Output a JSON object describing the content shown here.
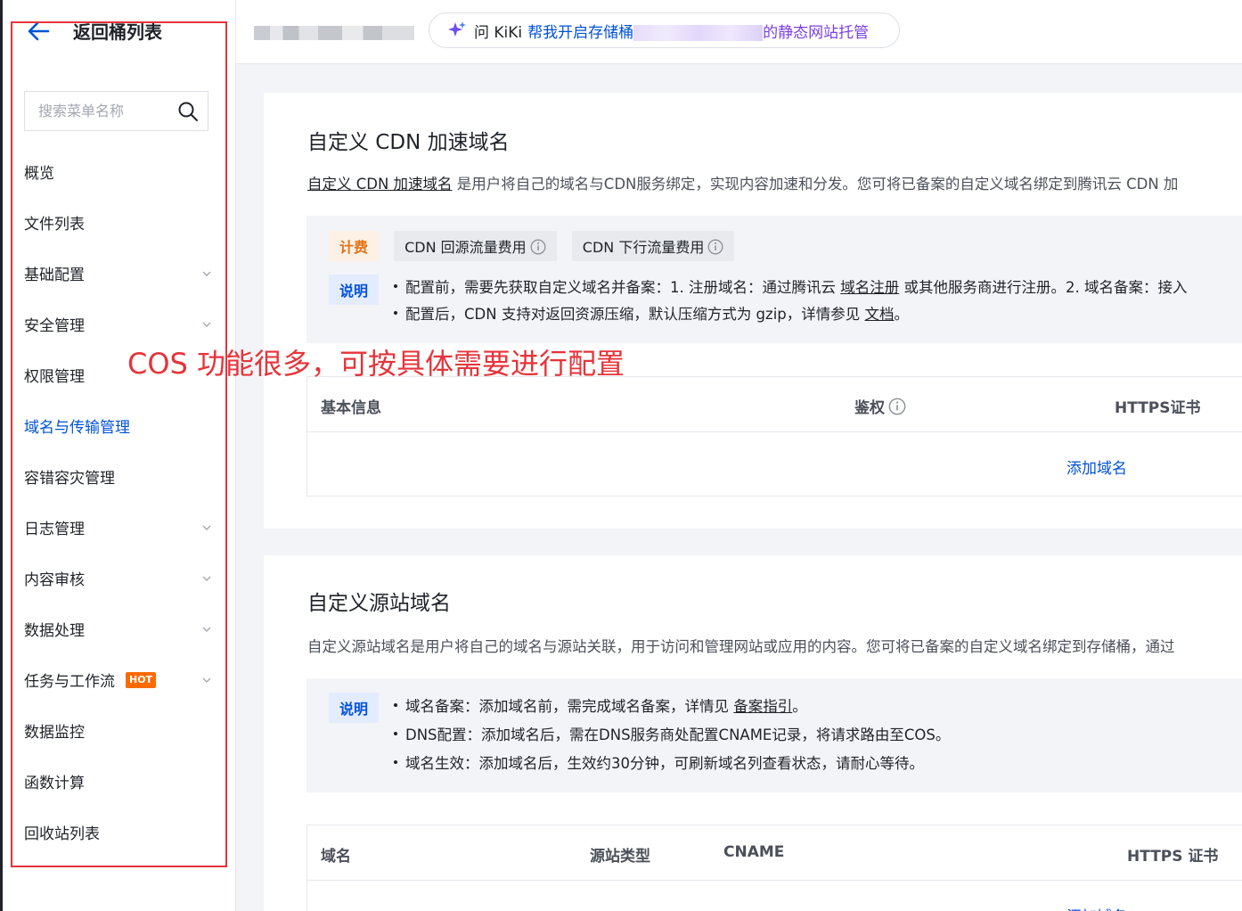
{
  "sidebar": {
    "back_title": "返回桶列表",
    "search_placeholder": "搜索菜单名称",
    "items": [
      {
        "label": "概览"
      },
      {
        "label": "文件列表"
      },
      {
        "label": "基础配置"
      },
      {
        "label": "安全管理"
      },
      {
        "label": "权限管理"
      },
      {
        "label": "域名与传输管理"
      },
      {
        "label": "容错容灾管理"
      },
      {
        "label": "日志管理"
      },
      {
        "label": "内容审核"
      },
      {
        "label": "数据处理"
      },
      {
        "label": "任务与工作流",
        "badge": "HOT"
      },
      {
        "label": "数据监控"
      },
      {
        "label": "函数计算"
      },
      {
        "label": "回收站列表"
      }
    ]
  },
  "topbar": {
    "kiki_label": "问 KiKi",
    "kiki_prompt": "帮我开启存储桶",
    "kiki_tail": "的静态网站托管"
  },
  "cdn": {
    "title": "自定义 CDN 加速域名",
    "desc_link": "自定义 CDN 加速域名",
    "desc_rest": " 是用户将自己的域名与CDN服务绑定，实现内容加速和分发。您可将已备案的自定义域名绑定到腾讯云 CDN 加",
    "tag_billing": "计费",
    "tag_fee1": "CDN 回源流量费用",
    "tag_fee2": "CDN 下行流量费用",
    "tag_note": "说明",
    "note1_a": "配置前，需要先获取自定义域名并备案：1. 注册域名：通过腾讯云 ",
    "note1_link": "域名注册",
    "note1_b": " 或其他服务商进行注册。2. 域名备案：接入",
    "note2_a": "配置后，CDN 支持对返回资源压缩，默认压缩方式为 gzip，详情参见 ",
    "note2_link": "文档",
    "note2_b": "。",
    "col_basic": "基本信息",
    "col_auth": "鉴权",
    "col_https": "HTTPS证书",
    "add_domain": "添加域名"
  },
  "origin": {
    "title": "自定义源站域名",
    "desc": "自定义源站域名是用户将自己的域名与源站关联，用于访问和管理网站或应用的内容。您可将已备案的自定义域名绑定到存储桶，通过",
    "tag_note": "说明",
    "note1_a": "域名备案：添加域名前，需完成域名备案，详情见 ",
    "note1_link": "备案指引",
    "note1_b": "。",
    "note2": "DNS配置：添加域名后，需在DNS服务商处配置CNAME记录，将请求路由至COS。",
    "note3": "域名生效：添加域名后，生效约30分钟，可刷新域名列查看状态，请耐心等待。",
    "col_domain": "域名",
    "col_type": "源站类型",
    "col_cname": "CNAME",
    "col_https": "HTTPS 证书",
    "add_domain": "添加域名"
  },
  "annotation": {
    "text": "COS 功能很多，可按具体需要进行配置",
    "color": "#e5343a"
  },
  "colors": {
    "accent": "#0052d9",
    "hot": "#ff6a00",
    "billing": "#e37318"
  }
}
